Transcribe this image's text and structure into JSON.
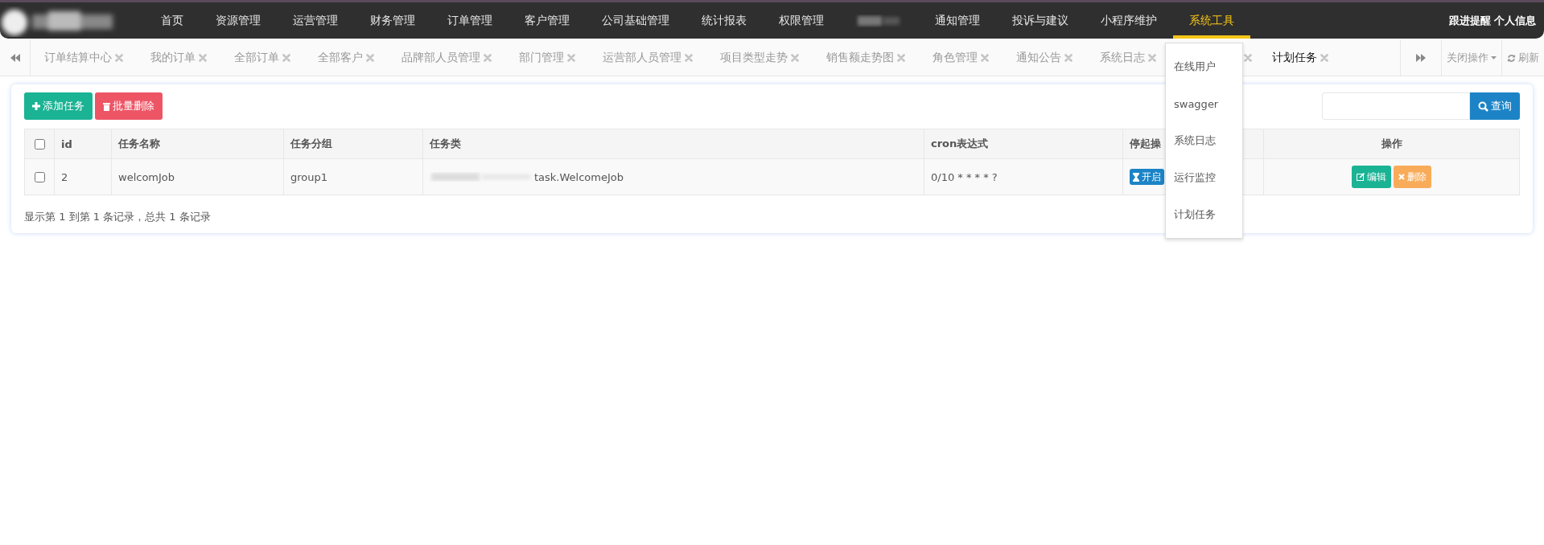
{
  "nav": {
    "items": [
      {
        "kind": "link",
        "label": "首页",
        "selected": false
      },
      {
        "kind": "link",
        "label": "资源管理",
        "selected": false
      },
      {
        "kind": "link",
        "label": "运营管理",
        "selected": false
      },
      {
        "kind": "link",
        "label": "财务管理",
        "selected": false
      },
      {
        "kind": "link",
        "label": "订单管理",
        "selected": false
      },
      {
        "kind": "link",
        "label": "客户管理",
        "selected": false
      },
      {
        "kind": "link",
        "label": "公司基础管理",
        "selected": false
      },
      {
        "kind": "link",
        "label": "统计报表",
        "selected": false
      },
      {
        "kind": "link",
        "label": "权限管理",
        "selected": false
      },
      {
        "kind": "blurred"
      },
      {
        "kind": "link",
        "label": "通知管理",
        "selected": false
      },
      {
        "kind": "link",
        "label": "投诉与建议",
        "selected": false
      },
      {
        "kind": "link",
        "label": "小程序维护",
        "selected": false
      },
      {
        "kind": "link",
        "label": "系统工具",
        "selected": true
      }
    ],
    "right": [
      "跟进提醒",
      "个人信息"
    ],
    "dropdown": [
      "在线用户",
      "swagger",
      "系统日志",
      "运行监控",
      "计划任务"
    ]
  },
  "tabs": {
    "items": [
      {
        "label": "订单结算中心",
        "selected": false
      },
      {
        "label": "我的订单",
        "selected": false
      },
      {
        "label": "全部订单",
        "selected": false
      },
      {
        "label": "全部客户",
        "selected": false
      },
      {
        "label": "品牌部人员管理",
        "selected": false
      },
      {
        "label": "部门管理",
        "selected": false
      },
      {
        "label": "运营部人员管理",
        "selected": false
      },
      {
        "label": "项目类型走势",
        "selected": false
      },
      {
        "label": "销售额走势图",
        "selected": false
      },
      {
        "label": "角色管理",
        "selected": false
      },
      {
        "label": "通知公告",
        "selected": false
      },
      {
        "label": "系统日志",
        "selected": false
      },
      {
        "kind": "hidden"
      },
      {
        "label": "计划任务",
        "selected": true
      }
    ],
    "close_menu": "关闭操作",
    "refresh": "刷新"
  },
  "toolbar": {
    "add": "添加任务",
    "batch_delete": "批量删除",
    "search_button": "查询"
  },
  "table": {
    "select_all": false,
    "columns": [
      "id",
      "任务名称",
      "任务分组",
      "任务类",
      "cron表达式",
      "停起操",
      "操作"
    ],
    "rows": [
      {
        "checked": false,
        "id": "2",
        "name": "welcomJob",
        "group": "group1",
        "class": "task.WelcomeJob",
        "cron": "0/10 * * * * ?",
        "toggle": "开启",
        "edit": "编辑",
        "delete": "删除"
      }
    ]
  },
  "footer": "显示第 1 到第 1 条记录，总共 1 条记录"
}
